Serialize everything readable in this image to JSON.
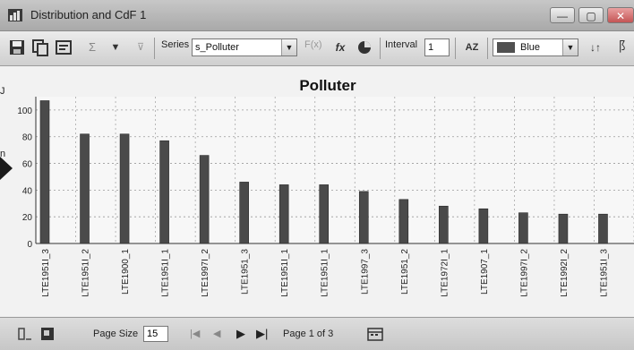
{
  "window": {
    "title": "Distribution and CdF 1",
    "minimize_glyph": "—",
    "maximize_glyph": "▢",
    "close_glyph": "✕"
  },
  "toolbar": {
    "save_icon": "save-icon",
    "copy_icon": "copy-icon",
    "properties_icon": "properties-icon",
    "sum_glyph": "Σ",
    "filter_glyph": "▼",
    "series_label": "Series",
    "series_value": "s_Polluter",
    "fx_label": "F(x)",
    "fx_italic": "fx",
    "interval_label": "Interval",
    "interval_value": "1",
    "az_label": "AZ",
    "color_value": "Blue",
    "sort_glyph": "↓↑",
    "chart_glyph": "⻏"
  },
  "chart_data": {
    "type": "bar",
    "title": "Polluter",
    "xlabel": "",
    "ylabel": "",
    "ylim": [
      0,
      110
    ],
    "yticks": [
      0,
      20,
      40,
      60,
      80,
      100
    ],
    "grid": true,
    "categories": [
      "LTE1951I_3",
      "LTE1951I_2",
      "LTE1900_1",
      "LTE1951I_1",
      "LTE1997I_2",
      "LTE1951_3",
      "LTE1951I_1",
      "LTE1951I_1",
      "LTE1997_3",
      "LTE1951_2",
      "LTE1972I_1",
      "LTE1907_1",
      "LTE1997I_2",
      "LTE1992I_2",
      "LTE1951I_3"
    ],
    "values": [
      107,
      82,
      82,
      77,
      66,
      46,
      44,
      44,
      39,
      33,
      28,
      26,
      23,
      22,
      22
    ],
    "series": [
      {
        "values": [
          107,
          82,
          82,
          77,
          66,
          46,
          44,
          44,
          39,
          33,
          28,
          26,
          23,
          22,
          22
        ]
      }
    ],
    "bar_color": "#4a4a4a"
  },
  "statusbar": {
    "page_size_label": "Page Size",
    "page_size_value": "15",
    "page_label": "Page 1 of 3",
    "first_glyph": "|◀",
    "prev_glyph": "◀",
    "next_glyph": "▶",
    "last_glyph": "▶|"
  }
}
